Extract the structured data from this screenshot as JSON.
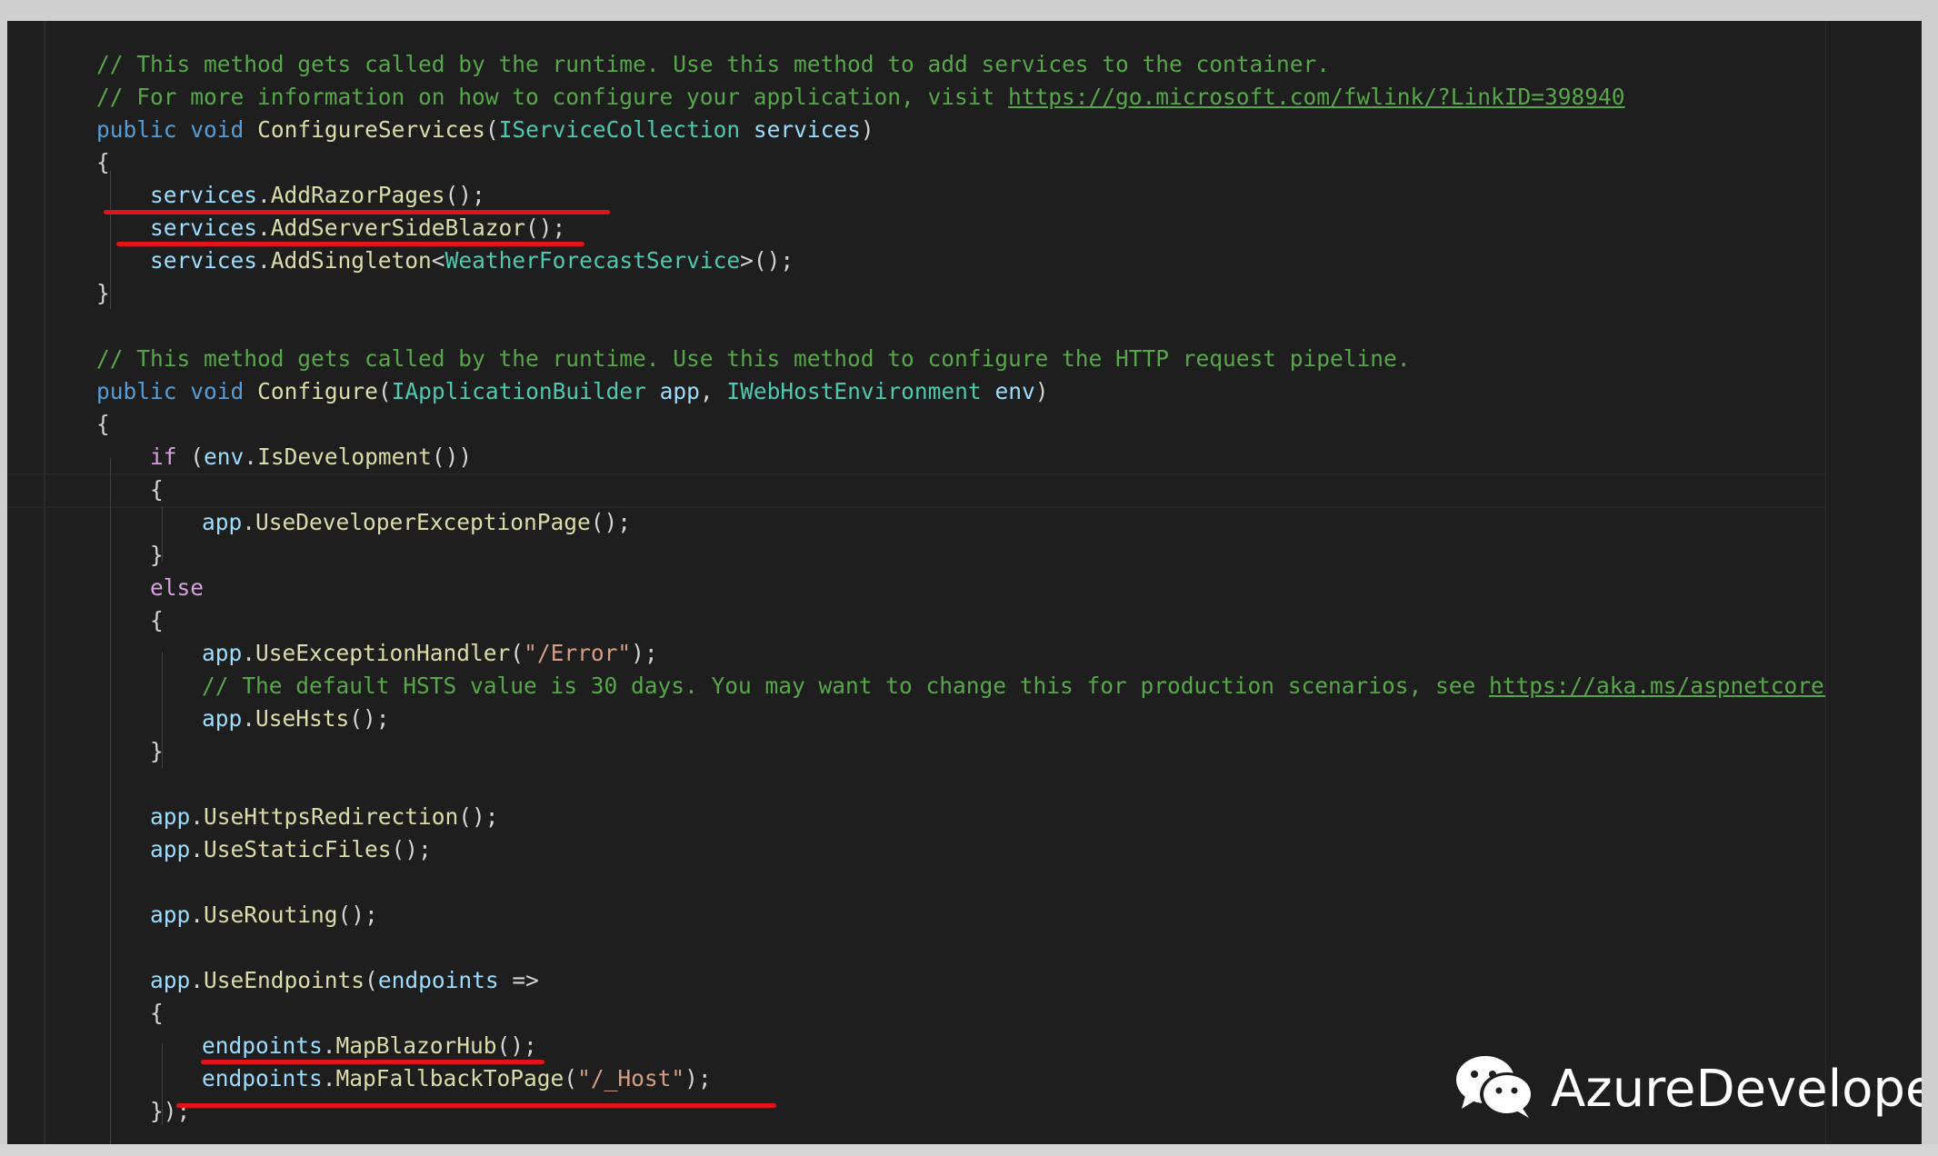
{
  "code": {
    "l1": "// This method gets called by the runtime. Use this method to add services to the container.",
    "l2a": "// For more information on how to configure your application, visit ",
    "l2b": "https://go.microsoft.com/fwlink/?LinkID=398940",
    "l3": {
      "kw1": "public",
      "kw2": "void",
      "fn": "ConfigureServices",
      "ty": "IServiceCollection",
      "id": "services"
    },
    "brace_open": "{",
    "brace_close": "}",
    "l5": {
      "id": "services",
      "fn": "AddRazorPages"
    },
    "l6": {
      "id": "services",
      "fn": "AddServerSideBlazor"
    },
    "l7": {
      "id": "services",
      "fn": "AddSingleton",
      "ty": "WeatherForecastService"
    },
    "l10": "// This method gets called by the runtime. Use this method to configure the HTTP request pipeline.",
    "l11": {
      "kw1": "public",
      "kw2": "void",
      "fn": "Configure",
      "ty1": "IApplicationBuilder",
      "id1": "app",
      "ty2": "IWebHostEnvironment",
      "id2": "env"
    },
    "l13": {
      "kw": "if",
      "id": "env",
      "fn": "IsDevelopment"
    },
    "l15": {
      "id": "app",
      "fn": "UseDeveloperExceptionPage"
    },
    "l17": {
      "kw": "else"
    },
    "l19": {
      "id": "app",
      "fn": "UseExceptionHandler",
      "st": "\"/Error\""
    },
    "l20a": "// The default HSTS value is 30 days. You may want to change this for production scenarios, see ",
    "l20b": "https://aka.ms/aspnetcore-h",
    "l21": {
      "id": "app",
      "fn": "UseHsts"
    },
    "l24": {
      "id": "app",
      "fn": "UseHttpsRedirection"
    },
    "l25": {
      "id": "app",
      "fn": "UseStaticFiles"
    },
    "l27": {
      "id": "app",
      "fn": "UseRouting"
    },
    "l29": {
      "id": "app",
      "fn": "UseEndpoints",
      "param": "endpoints"
    },
    "l31": {
      "id": "endpoints",
      "fn": "MapBlazorHub"
    },
    "l32": {
      "id": "endpoints",
      "fn": "MapFallbackToPage",
      "st": "\"/_Host\""
    },
    "l33": "});"
  },
  "watermark": {
    "text": "AzureDeveloper",
    "icon": "wechat-icon"
  },
  "colors": {
    "background": "#1e1e1e",
    "comment": "#57a64a",
    "keyword": "#569cd6",
    "type": "#4ec9b0",
    "method": "#dcdcaa",
    "identifier": "#9cdcfe",
    "string": "#d69d85",
    "annotation": "#e0141a"
  }
}
